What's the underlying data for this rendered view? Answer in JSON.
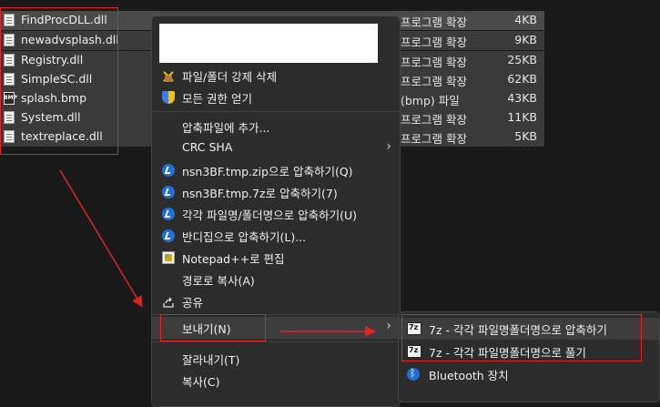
{
  "files": [
    {
      "name": "FindProcDLL.dll",
      "type": "프로그램 확장",
      "size": "4KB",
      "icon": "dll-file-icon"
    },
    {
      "name": "newadvsplash.dll",
      "type": "프로그램 확장",
      "size": "9KB",
      "icon": "dll-file-icon"
    },
    {
      "name": "Registry.dll",
      "type": "프로그램 확장",
      "size": "25KB",
      "icon": "dll-file-icon"
    },
    {
      "name": "SimpleSC.dll",
      "type": "프로그램 확장",
      "size": "62KB",
      "icon": "dll-file-icon"
    },
    {
      "name": "splash.bmp",
      "type": "(bmp) 파일",
      "size": "43KB",
      "icon": "bmp-file-icon"
    },
    {
      "name": "System.dll",
      "type": "프로그램 확장",
      "size": "11KB",
      "icon": "dll-file-icon"
    },
    {
      "name": "textreplace.dll",
      "type": "프로그램 확장",
      "size": "5KB",
      "icon": "dll-file-icon"
    }
  ],
  "context_menu": {
    "items": [
      {
        "label": "파일/폴더 강제 삭제",
        "icon": "trash-icon"
      },
      {
        "label": "모든 권한 얻기",
        "icon": "shield-icon"
      },
      {
        "label": "압축파일에 추가...",
        "icon": ""
      },
      {
        "label": "CRC SHA",
        "icon": "",
        "submenu": true
      },
      {
        "label": "nsn3BF.tmp.zip으로 압축하기(Q)",
        "icon": "bandizip-icon"
      },
      {
        "label": "nsn3BF.tmp.7z로 압축하기(7)",
        "icon": "bandizip-icon"
      },
      {
        "label": "각각 파일명/폴더명으로 압축하기(U)",
        "icon": "bandizip-icon"
      },
      {
        "label": "반디집으로 압축하기(L)...",
        "icon": "bandizip-icon"
      },
      {
        "label": "Notepad++로 편집",
        "icon": "notepadpp-icon"
      },
      {
        "label": "경로로 복사(A)",
        "icon": ""
      },
      {
        "label": "공유",
        "icon": "share-icon"
      },
      {
        "label": "보내기(N)",
        "icon": "",
        "submenu": true
      },
      {
        "label": "잘라내기(T)",
        "icon": ""
      },
      {
        "label": "복사(C)",
        "icon": ""
      }
    ]
  },
  "send_to_submenu": {
    "items": [
      {
        "label": "7z - 각각 파일명폴더명으로 압축하기",
        "icon": "7z-icon"
      },
      {
        "label": "7z - 각각 파일명폴더명으로 풀기",
        "icon": "7z-icon"
      },
      {
        "label": "Bluetooth 장치",
        "icon": "bluetooth-icon"
      }
    ]
  },
  "annotation_color": "#e12323"
}
